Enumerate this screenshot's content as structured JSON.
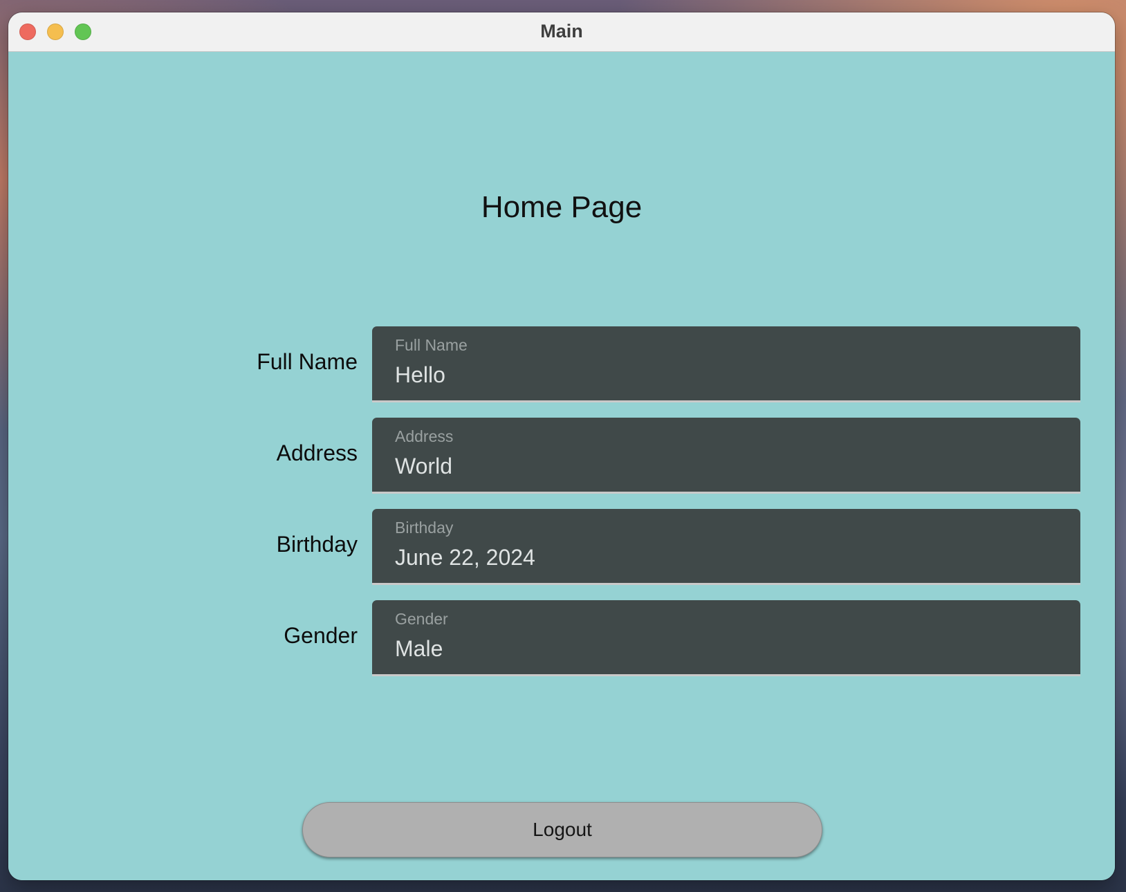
{
  "window": {
    "title": "Main"
  },
  "page": {
    "title": "Home Page"
  },
  "form": {
    "fields": [
      {
        "row_label": "Full Name",
        "floating_label": "Full Name",
        "value": "Hello"
      },
      {
        "row_label": "Address",
        "floating_label": "Address",
        "value": "World"
      },
      {
        "row_label": "Birthday",
        "floating_label": "Birthday",
        "value": "June 22, 2024"
      },
      {
        "row_label": "Gender",
        "floating_label": "Gender",
        "value": "Male"
      }
    ]
  },
  "actions": {
    "logout_label": "Logout"
  },
  "colors": {
    "background": "#95d2d3",
    "field_background": "#404949",
    "button_background": "#b0b0b0"
  }
}
